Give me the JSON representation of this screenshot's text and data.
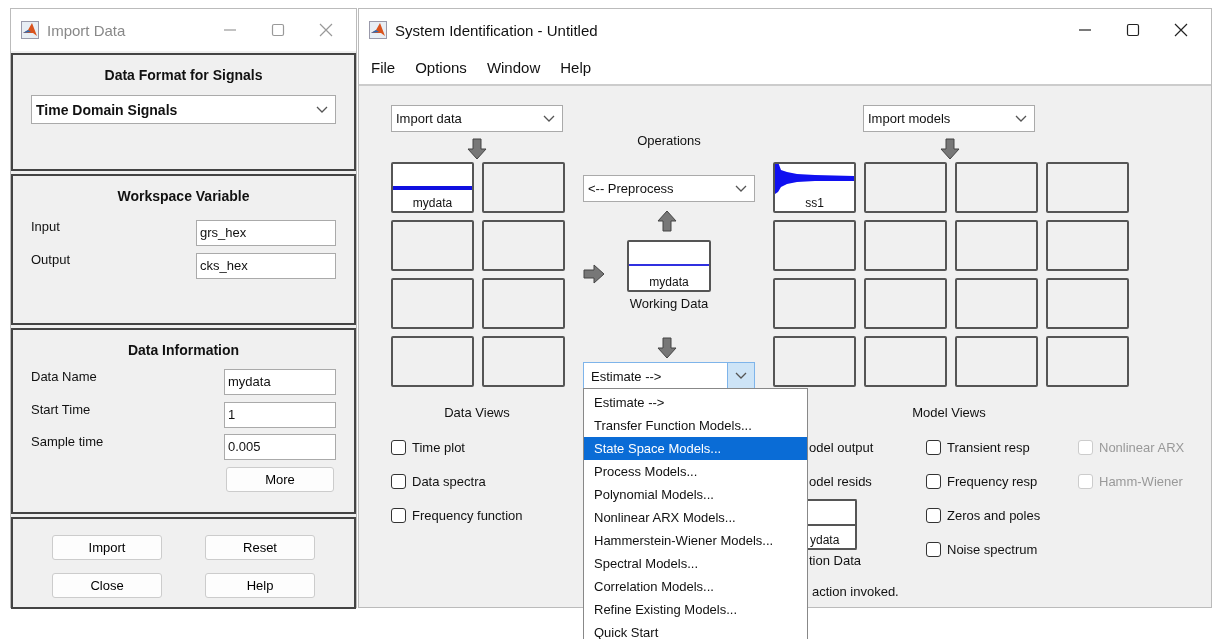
{
  "import_window": {
    "title": "Import Data",
    "data_format": {
      "heading": "Data Format for Signals",
      "value": "Time Domain Signals"
    },
    "workspace": {
      "heading": "Workspace Variable",
      "fields": [
        {
          "label": "Input",
          "value": "grs_hex"
        },
        {
          "label": "Output",
          "value": "cks_hex"
        }
      ]
    },
    "info": {
      "heading": "Data Information",
      "fields": [
        {
          "label": "Data Name",
          "value": "mydata"
        },
        {
          "label": "Start Time",
          "value": "1"
        },
        {
          "label": "Sample time",
          "value": "0.005"
        }
      ],
      "more_button": "More"
    },
    "buttons": [
      "Import",
      "Reset",
      "Close",
      "Help"
    ]
  },
  "sysid_window": {
    "title": "System Identification - Untitled",
    "menu": [
      "File",
      "Options",
      "Window",
      "Help"
    ],
    "import_data": "Import data",
    "data_board": [
      {
        "kind": "data",
        "label": "mydata"
      },
      {
        "kind": "empty"
      },
      {
        "kind": "empty"
      },
      {
        "kind": "empty"
      },
      {
        "kind": "empty"
      },
      {
        "kind": "empty"
      },
      {
        "kind": "empty"
      },
      {
        "kind": "empty"
      }
    ],
    "operations": {
      "heading": "Operations",
      "preprocess": "<-- Preprocess",
      "working_data": {
        "label": "mydata",
        "caption": "Working Data"
      },
      "estimate": "Estimate -->"
    },
    "import_models": "Import models",
    "model_board": [
      {
        "kind": "model",
        "label": "ss1"
      },
      {
        "kind": "empty"
      },
      {
        "kind": "empty"
      },
      {
        "kind": "empty"
      },
      {
        "kind": "empty"
      },
      {
        "kind": "empty"
      },
      {
        "kind": "empty"
      },
      {
        "kind": "empty"
      },
      {
        "kind": "empty"
      },
      {
        "kind": "empty"
      },
      {
        "kind": "empty"
      },
      {
        "kind": "empty"
      },
      {
        "kind": "empty"
      },
      {
        "kind": "empty"
      },
      {
        "kind": "empty"
      },
      {
        "kind": "empty"
      }
    ],
    "data_views": {
      "heading": "Data Views",
      "options": [
        {
          "label": "Time plot",
          "checked": false
        },
        {
          "label": "Data spectra",
          "checked": false
        },
        {
          "label": "Frequency function",
          "checked": false
        }
      ]
    },
    "model_views": {
      "heading": "Model Views",
      "covered_options": [
        "odel output",
        "odel resids"
      ],
      "options": [
        {
          "label": "Transient resp",
          "checked": false,
          "disabled": false
        },
        {
          "label": "Frequency resp",
          "checked": false,
          "disabled": false
        },
        {
          "label": "Zeros and poles",
          "checked": false,
          "disabled": false
        },
        {
          "label": "Noise spectrum",
          "checked": false,
          "disabled": false
        }
      ],
      "extra_options": [
        {
          "label": "Nonlinear ARX",
          "checked": false,
          "disabled": true
        },
        {
          "label": "Hamm-Wiener",
          "checked": false,
          "disabled": true
        }
      ]
    },
    "validation_data": {
      "label": "ydata",
      "caption": "tion Data"
    },
    "status": "action invoked."
  },
  "estimate_menu": [
    {
      "label": "Estimate -->",
      "selected": false
    },
    {
      "label": "Transfer Function Models...",
      "selected": false
    },
    {
      "label": "State Space Models...",
      "selected": true
    },
    {
      "label": "Process Models...",
      "selected": false
    },
    {
      "label": "Polynomial Models...",
      "selected": false
    },
    {
      "label": "Nonlinear ARX Models...",
      "selected": false
    },
    {
      "label": "Hammerstein-Wiener Models...",
      "selected": false
    },
    {
      "label": "Spectral Models...",
      "selected": false
    },
    {
      "label": "Correlation Models...",
      "selected": false
    },
    {
      "label": "Refine Existing Models...",
      "selected": false
    },
    {
      "label": "Quick Start",
      "selected": false
    }
  ]
}
